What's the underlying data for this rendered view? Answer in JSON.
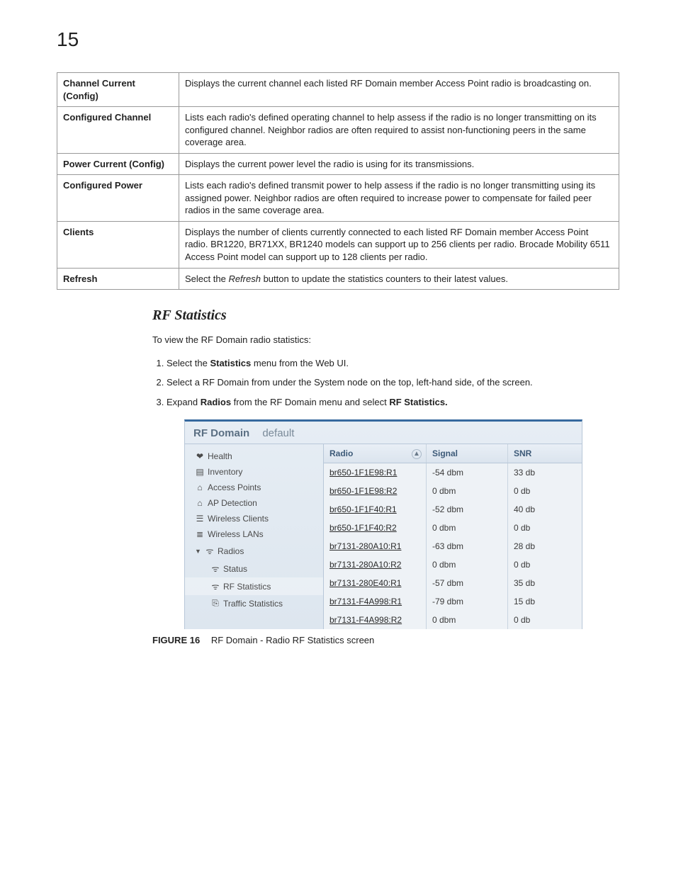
{
  "page_number": "15",
  "def_rows": [
    {
      "key": "Channel Current (Config)",
      "desc": "Displays the current channel each listed RF Domain member Access Point radio is broadcasting on."
    },
    {
      "key": "Configured Channel",
      "desc": "Lists each radio's defined operating channel to help assess if the radio is no longer transmitting on its configured channel. Neighbor radios are often required to assist non-functioning peers in the same coverage area."
    },
    {
      "key": "Power Current (Config)",
      "desc": "Displays the current power level the radio is using for its transmissions."
    },
    {
      "key": "Configured Power",
      "desc": "Lists each radio's defined transmit power to help assess if the radio is no longer transmitting using its assigned power. Neighbor radios are often required to increase power to compensate for failed peer radios in the same coverage area."
    },
    {
      "key": "Clients",
      "desc": "Displays the number of clients currently connected to each listed RF Domain member Access Point radio. BR1220, BR71XX, BR1240 models can support up to 256 clients per radio. Brocade Mobility 6511 Access Point model can support up to 128 clients per radio."
    }
  ],
  "refresh_row": {
    "key": "Refresh",
    "pre": "Select the ",
    "btn": "Refresh",
    "post": " button to update the statistics counters to their latest values."
  },
  "section_heading": "RF Statistics",
  "intro": "To view the RF Domain radio statistics:",
  "steps": {
    "s1_pre": "Select the ",
    "s1_b": "Statistics",
    "s1_post": " menu from the Web UI.",
    "s2": "Select a RF Domain from under the System node on the top, left-hand side, of the screen.",
    "s3_pre": "Expand ",
    "s3_b1": "Radios",
    "s3_mid": " from the RF Domain menu and select ",
    "s3_b2": "RF Statistics."
  },
  "screenshot": {
    "header_label": "RF Domain",
    "header_name": "default",
    "nav": [
      {
        "label": "Health",
        "icon": "❤"
      },
      {
        "label": "Inventory",
        "icon": "▤"
      },
      {
        "label": "Access Points",
        "icon": "⌂"
      },
      {
        "label": "AP Detection",
        "icon": "⌂"
      },
      {
        "label": "Wireless Clients",
        "icon": "☰"
      },
      {
        "label": "Wireless LANs",
        "icon": "≣"
      }
    ],
    "radios_label": "Radios",
    "radios_children": [
      {
        "label": "Status"
      },
      {
        "label": "RF Statistics"
      },
      {
        "label": "Traffic Statistics"
      }
    ],
    "columns": {
      "radio": "Radio",
      "signal": "Signal",
      "snr": "SNR"
    },
    "sort_indicator": "▲",
    "rows": [
      {
        "radio": "br650-1F1E98:R1",
        "signal": "-54 dbm",
        "snr": "33 db"
      },
      {
        "radio": "br650-1F1E98:R2",
        "signal": "0 dbm",
        "snr": "0 db"
      },
      {
        "radio": "br650-1F1F40:R1",
        "signal": "-52 dbm",
        "snr": "40 db"
      },
      {
        "radio": "br650-1F1F40:R2",
        "signal": "0 dbm",
        "snr": "0 db"
      },
      {
        "radio": "br7131-280A10:R1",
        "signal": "-63 dbm",
        "snr": "28 db"
      },
      {
        "radio": "br7131-280A10:R2",
        "signal": "0 dbm",
        "snr": "0 db"
      },
      {
        "radio": "br7131-280E40:R1",
        "signal": "-57 dbm",
        "snr": "35 db"
      },
      {
        "radio": "br7131-F4A998:R1",
        "signal": "-79 dbm",
        "snr": "15 db"
      },
      {
        "radio": "br7131-F4A998:R2",
        "signal": "0 dbm",
        "snr": "0 db"
      }
    ]
  },
  "figure": {
    "label": "FIGURE 16",
    "caption": "RF Domain - Radio RF Statistics screen"
  }
}
